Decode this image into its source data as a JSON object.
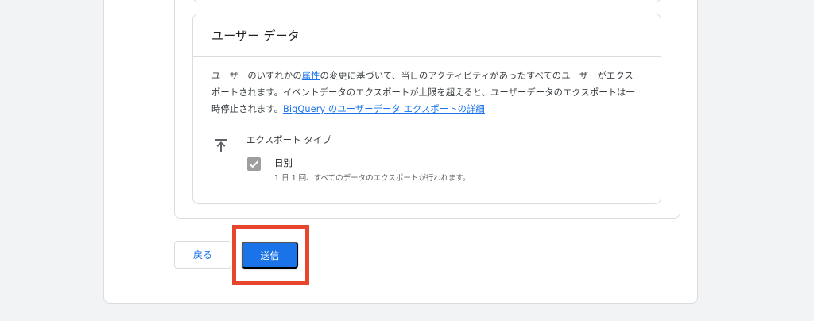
{
  "user_data_card": {
    "title": "ユーザー データ",
    "description_before_link": "ユーザーのいずれかの",
    "attribute_link": "属性",
    "description_middle": "の変更に基づいて、当日のアクティビティがあったすべてのユーザーがエクスポートされます。イベントデータのエクスポートが上限を超えると、ユーザーデータのエクスポートは一時停止されます。",
    "details_link": "BigQuery のユーザーデータ エクスポートの詳細",
    "export_type_label": "エクスポート タイプ",
    "export_icon": "upload-icon",
    "daily_option": {
      "label": "日別",
      "description": "1 日 1 回、すべてのデータのエクスポートが行われます。",
      "checked": true
    }
  },
  "actions": {
    "back_label": "戻る",
    "submit_label": "送信"
  },
  "colors": {
    "accent": "#1a73e8",
    "highlight": "#e8452e",
    "checkbox_disabled": "#9e9e9e"
  }
}
